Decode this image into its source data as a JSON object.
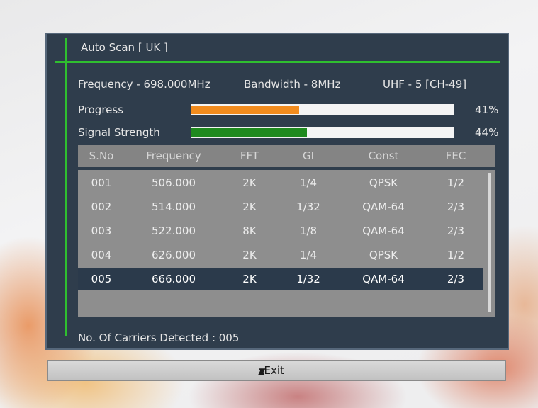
{
  "dialog": {
    "title": "Auto Scan [ UK ]"
  },
  "info": {
    "frequency": "Frequency - 698.000MHz",
    "bandwidth": "Bandwidth - 8MHz",
    "channel": "UHF - 5 [CH-49]"
  },
  "progress": {
    "label": "Progress",
    "value_text": "41%",
    "value": 41,
    "color": "#f28c1e"
  },
  "signal": {
    "label": "Signal Strength",
    "value_text": "44%",
    "value": 44,
    "color": "#1f8a1f"
  },
  "table": {
    "headers": [
      "S.No",
      "Frequency",
      "FFT",
      "GI",
      "Const",
      "FEC"
    ],
    "rows": [
      [
        "001",
        "506.000",
        "2K",
        "1/4",
        "QPSK",
        "1/2"
      ],
      [
        "002",
        "514.000",
        "2K",
        "1/32",
        "QAM-64",
        "2/3"
      ],
      [
        "003",
        "522.000",
        "8K",
        "1/8",
        "QAM-64",
        "2/3"
      ],
      [
        "004",
        "626.000",
        "2K",
        "1/4",
        "QPSK",
        "1/2"
      ],
      [
        "005",
        "666.000",
        "2K",
        "1/32",
        "QAM-64",
        "2/3"
      ]
    ],
    "selected_row": 4
  },
  "footer": {
    "carriers": "No. Of Carriers Detected : 005"
  },
  "exit": {
    "label": "Exit",
    "icon": "up-down-arrows-icon"
  }
}
